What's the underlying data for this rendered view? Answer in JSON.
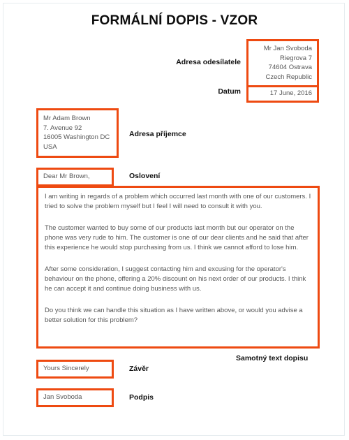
{
  "document": {
    "title": "FORMÁLNÍ DOPIS - VZOR"
  },
  "theme": {
    "accent": "#ee4a11",
    "text": "#565656",
    "label_text": "#111111",
    "page_border": "#e6ecef"
  },
  "sender": {
    "label": "Adresa odesílatele",
    "lines": [
      "Mr Jan Svoboda",
      "Riegrova 7",
      "74604 Ostrava",
      "Czech Republic"
    ],
    "text": "Mr Jan Svoboda\nRiegrova 7\n74604 Ostrava\nCzech Republic"
  },
  "date": {
    "label": "Datum",
    "value": "17 June, 2016"
  },
  "recipient": {
    "label": "Adresa příjemce",
    "lines": [
      "Mr Adam Brown",
      "7. Avenue 92",
      "16005 Washington DC",
      "USA"
    ],
    "text": "Mr Adam Brown\n7. Avenue 92\n16005 Washington DC\nUSA"
  },
  "salutation": {
    "label": "Oslovení",
    "value": "Dear Mr Brown,"
  },
  "body": {
    "label": "Samotný text dopisu",
    "paragraphs": [
      "I am writing in regards of a problem which occurred last month with one of our customers. I tried to solve the problem myself but I feel I will need to consult it with you.",
      "The customer wanted to buy some of our products last month but our operator on the phone was very rude to him. The customer is one of our dear clients and he said that after this experience he would stop purchasing from us. I think we cannot afford to lose him.",
      "After some consideration, I suggest contacting him and excusing for the operator's behaviour on the phone, offering a 20% discount on his next order of our products. I think he can accept it and continue doing business with us.",
      "Do you think we can handle this situation as I have written above, or would you advise a better solution for this problem?"
    ]
  },
  "closing": {
    "label": "Závěr",
    "value": "Yours Sincerely"
  },
  "signature": {
    "label": "Podpis",
    "value": "Jan Svoboda"
  }
}
